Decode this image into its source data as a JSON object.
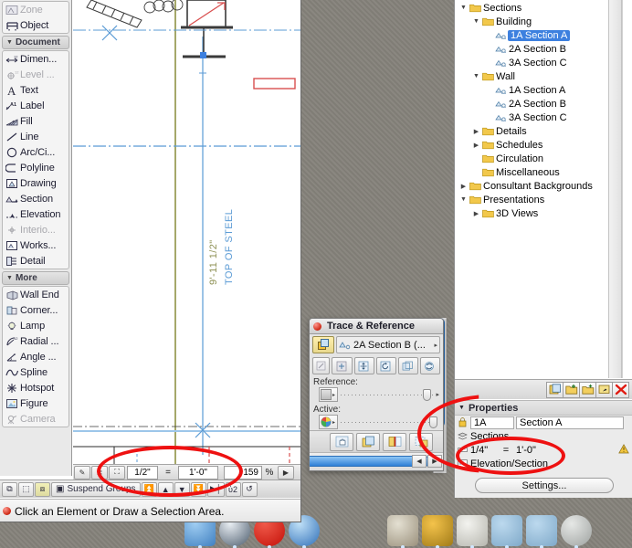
{
  "app": {
    "status_message": "Click an Element or Draw a Selection Area."
  },
  "toolbox": {
    "top_items": [
      {
        "label": "Zone",
        "icon": "zone-icon",
        "dim": true
      },
      {
        "label": "Object",
        "icon": "object-icon",
        "dim": false
      }
    ],
    "sections": [
      {
        "header": "Document",
        "items": [
          {
            "label": "Dimen...",
            "icon": "dimension-icon",
            "dim": false
          },
          {
            "label": "Level ...",
            "icon": "level-dimension-icon",
            "dim": true
          },
          {
            "label": "Text",
            "icon": "text-icon",
            "dim": false
          },
          {
            "label": "Label",
            "icon": "label-icon",
            "dim": false
          },
          {
            "label": "Fill",
            "icon": "fill-icon",
            "dim": false
          },
          {
            "label": "Line",
            "icon": "line-icon",
            "dim": false
          },
          {
            "label": "Arc/Ci...",
            "icon": "arc-circle-icon",
            "dim": false
          },
          {
            "label": "Polyline",
            "icon": "polyline-icon",
            "dim": false
          },
          {
            "label": "Drawing",
            "icon": "drawing-icon",
            "dim": false
          },
          {
            "label": "Section",
            "icon": "section-icon",
            "dim": false
          },
          {
            "label": "Elevation",
            "icon": "elevation-icon",
            "dim": false
          },
          {
            "label": "Interio...",
            "icon": "interior-elevation-icon",
            "dim": true
          },
          {
            "label": "Works...",
            "icon": "worksheet-icon",
            "dim": false
          },
          {
            "label": "Detail",
            "icon": "detail-icon",
            "dim": false
          }
        ]
      },
      {
        "header": "More",
        "items": [
          {
            "label": "Wall End",
            "icon": "wall-end-icon",
            "dim": false
          },
          {
            "label": "Corner...",
            "icon": "corner-window-icon",
            "dim": false
          },
          {
            "label": "Lamp",
            "icon": "lamp-icon",
            "dim": false
          },
          {
            "label": "Radial ...",
            "icon": "radial-dimension-icon",
            "dim": false
          },
          {
            "label": "Angle ...",
            "icon": "angle-dimension-icon",
            "dim": false
          },
          {
            "label": "Spline",
            "icon": "spline-icon",
            "dim": false
          },
          {
            "label": "Hotspot",
            "icon": "hotspot-icon",
            "dim": false
          },
          {
            "label": "Figure",
            "icon": "figure-icon",
            "dim": false
          },
          {
            "label": "Camera",
            "icon": "camera-icon",
            "dim": true
          }
        ]
      }
    ]
  },
  "canvas": {
    "dimension_text": "9'-11 1/2\"",
    "elevation_label": "TOP OF STEEL",
    "colors": {
      "dim_blue": "#5b9bd5",
      "grid_olive": "#a5a86a",
      "marker_red": "#d94f4f",
      "highlight_red": "#ee1111"
    }
  },
  "scale_bar": {
    "scale_numerator": "1/2\"",
    "equals": "=",
    "scale_denominator": "1'-0\"",
    "zoom_value": "159",
    "zoom_unit": "%",
    "buttons": [
      {
        "name": "pen-set-icon",
        "glyph": "✎"
      },
      {
        "name": "layer-icon",
        "glyph": "≣"
      },
      {
        "name": "scale-zoom-icon",
        "glyph": "⛶"
      }
    ],
    "next_arrow": "▶"
  },
  "status_toolbar": {
    "buttons": [
      {
        "name": "selection-arrow-icon",
        "glyph": "⧉",
        "on": false
      },
      {
        "name": "marquee-icon",
        "glyph": "⬚",
        "on": false
      },
      {
        "name": "group-suspend-icon",
        "glyph": "⧈",
        "on": true
      },
      {
        "name": "suspend-groups-toggle",
        "glyph": "▣",
        "on": false,
        "label": "Suspend Groups",
        "wide": true
      },
      {
        "name": "send-to-back-icon",
        "glyph": "⏫",
        "on": false
      },
      {
        "name": "send-backward-icon",
        "glyph": "▲",
        "on": false
      },
      {
        "name": "bring-forward-icon",
        "glyph": "▼",
        "on": false
      },
      {
        "name": "bring-to-front-icon",
        "glyph": "⏬",
        "on": false
      },
      {
        "name": "align-icon",
        "glyph": "▶│",
        "on": false
      },
      {
        "name": "lock-icon",
        "glyph": "ὑ2",
        "on": false
      },
      {
        "name": "unlock-icon",
        "glyph": "↺",
        "on": false
      }
    ]
  },
  "navigator": {
    "tree": [
      {
        "depth": 1,
        "twisty": "down",
        "icon": "folder-icon",
        "label": "Sections",
        "selected": false
      },
      {
        "depth": 2,
        "twisty": "down",
        "icon": "folder-icon",
        "label": "Building",
        "selected": false
      },
      {
        "depth": 3,
        "twisty": "none",
        "icon": "section-icon",
        "label": "1A Section A",
        "selected": true
      },
      {
        "depth": 3,
        "twisty": "none",
        "icon": "section-icon",
        "label": "2A Section B",
        "selected": false
      },
      {
        "depth": 3,
        "twisty": "none",
        "icon": "section-icon",
        "label": "3A Section C",
        "selected": false
      },
      {
        "depth": 2,
        "twisty": "down",
        "icon": "folder-icon",
        "label": "Wall",
        "selected": false
      },
      {
        "depth": 3,
        "twisty": "none",
        "icon": "section-icon",
        "label": "1A Section A",
        "selected": false
      },
      {
        "depth": 3,
        "twisty": "none",
        "icon": "section-icon",
        "label": "2A Section B",
        "selected": false
      },
      {
        "depth": 3,
        "twisty": "none",
        "icon": "section-icon",
        "label": "3A Section C",
        "selected": false
      },
      {
        "depth": 2,
        "twisty": "right",
        "icon": "folder-icon",
        "label": "Details",
        "selected": false
      },
      {
        "depth": 2,
        "twisty": "right",
        "icon": "folder-icon",
        "label": "Schedules",
        "selected": false
      },
      {
        "depth": 2,
        "twisty": "none",
        "icon": "folder-icon",
        "label": "Circulation",
        "selected": false
      },
      {
        "depth": 2,
        "twisty": "none",
        "icon": "folder-icon",
        "label": "Miscellaneous",
        "selected": false
      },
      {
        "depth": 1,
        "twisty": "right",
        "icon": "folder-icon",
        "label": "Consultant Backgrounds",
        "selected": false
      },
      {
        "depth": 1,
        "twisty": "down",
        "icon": "folder-icon",
        "label": "Presentations",
        "selected": false
      },
      {
        "depth": 2,
        "twisty": "right",
        "icon": "folder-icon",
        "label": "3D Views",
        "selected": false
      }
    ],
    "toolbar_buttons": [
      {
        "name": "new-viewpoint-button",
        "glyph": "◱"
      },
      {
        "name": "new-folder-clone-button",
        "glyph": "◰"
      },
      {
        "name": "new-folder-button",
        "glyph": "◿"
      },
      {
        "name": "rename-item-button",
        "glyph": "◳"
      },
      {
        "name": "delete-item-button",
        "glyph": "✕"
      }
    ]
  },
  "properties": {
    "header": "Properties",
    "id_value": "1A",
    "name_value": "Section A",
    "folder_value": "Sections",
    "scale_numerator": "1/4\"",
    "scale_equals": "=",
    "scale_denominator": "1'-0\"",
    "type_value": "Elevation/Section",
    "warning_icon": "warning-triangle-icon",
    "settings_label": "Settings..."
  },
  "trace": {
    "title": "Trace & Reference",
    "close_button": "close-button",
    "reference_value": "2A Section B (...",
    "reference_label": "Reference:",
    "active_label": "Active:",
    "toolbar_buttons": [
      {
        "name": "trace-toggle-button",
        "glyph": "⧉",
        "active": true
      },
      {
        "name": "trace-rotate-button",
        "glyph": "↻",
        "active": false
      },
      {
        "name": "trace-move-button",
        "glyph": "✥",
        "active": false
      },
      {
        "name": "trace-reset-button",
        "glyph": "↺",
        "active": false
      },
      {
        "name": "trace-align-button",
        "glyph": "◱",
        "active": false
      },
      {
        "name": "trace-swap-button",
        "glyph": "⇄",
        "active": false
      }
    ],
    "bottom_buttons": [
      {
        "name": "trace-drag-button",
        "glyph": "✋"
      },
      {
        "name": "trace-compare-button",
        "glyph": "◰"
      },
      {
        "name": "trace-splitter-button",
        "glyph": "▏"
      },
      {
        "name": "trace-frame-button",
        "glyph": "◳"
      }
    ],
    "scroll_left_arrow": "◀",
    "scroll_right_arrow": "▶"
  },
  "dock": {
    "items": [
      {
        "name": "dock-finder",
        "color1": "#9fcdf2",
        "color2": "#3f7fc0"
      },
      {
        "name": "dock-safari",
        "color1": "#e8edf2",
        "color2": "#4d5d6e"
      },
      {
        "name": "dock-opera",
        "color1": "#f05a4a",
        "color2": "#c41008"
      },
      {
        "name": "dock-browser",
        "color1": "#bfe0f7",
        "color2": "#2f6fb8"
      },
      {
        "name": "dock-iphoto",
        "color1": "#e4e0d2",
        "color2": "#9a907c"
      },
      {
        "name": "dock-keychain",
        "color1": "#f4c34b",
        "color2": "#a07a18"
      },
      {
        "name": "dock-preview",
        "color1": "#f3f3ef",
        "color2": "#b6b6ae"
      },
      {
        "name": "dock-folder-1",
        "color1": "#bcd9ee",
        "color2": "#7fa9c9"
      },
      {
        "name": "dock-folder-2",
        "color1": "#bcd9ee",
        "color2": "#7fa9c9"
      },
      {
        "name": "dock-trash",
        "color1": "#e6e8e6",
        "color2": "#9ea2a0"
      }
    ]
  }
}
